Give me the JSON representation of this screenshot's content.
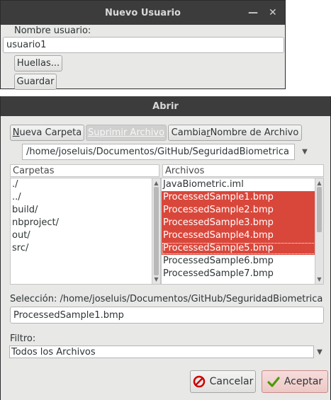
{
  "window1": {
    "title": "Nuevo Usuario",
    "minimize_glyph": "—",
    "close_glyph": "✕",
    "username_label": "Nombre usuario:",
    "username_value": "usuario1",
    "huellas_button": "Huellas...",
    "guardar_button": "Guardar"
  },
  "window2": {
    "title": "Abrir",
    "toolbar": {
      "new_folder": {
        "first": "N",
        "rest": "ueva Carpeta"
      },
      "delete_file": "Suprimir Archivo",
      "rename_file": {
        "before": "Cambia",
        "u": "r",
        "after": " Nombre de Archivo"
      }
    },
    "path": "/home/joseluis/Documentos/GitHub/SeguridadBiometrica",
    "folders_header": "Carpetas",
    "files_header": "Archivos",
    "folders": [
      "./",
      "../",
      "build/",
      "nbproject/",
      "out/",
      "src/"
    ],
    "files": [
      {
        "name": "JavaBiometric.iml",
        "selected": false,
        "focus": false
      },
      {
        "name": "ProcessedSample1.bmp",
        "selected": true,
        "focus": false
      },
      {
        "name": "ProcessedSample2.bmp",
        "selected": true,
        "focus": false
      },
      {
        "name": "ProcessedSample3.bmp",
        "selected": true,
        "focus": false
      },
      {
        "name": "ProcessedSample4.bmp",
        "selected": true,
        "focus": false
      },
      {
        "name": "ProcessedSample5.bmp",
        "selected": true,
        "focus": true
      },
      {
        "name": "ProcessedSample6.bmp",
        "selected": false,
        "focus": false
      },
      {
        "name": "ProcessedSample7.bmp",
        "selected": false,
        "focus": false
      }
    ],
    "selection_label": "Selección: /home/joseluis/Documentos/GitHub/SeguridadBiometrica",
    "selection_value": "ProcessedSample1.bmp",
    "filter_label": "Filtro:",
    "filter_value": "Todos los Archivos",
    "cancel_button": "Cancelar",
    "accept_button": "Aceptar",
    "colors": {
      "selection": "#d9473b",
      "titlebar": "#3c3c3c",
      "cancel_icon": "#cc0000",
      "accept_icon": "#4e9a06"
    }
  }
}
